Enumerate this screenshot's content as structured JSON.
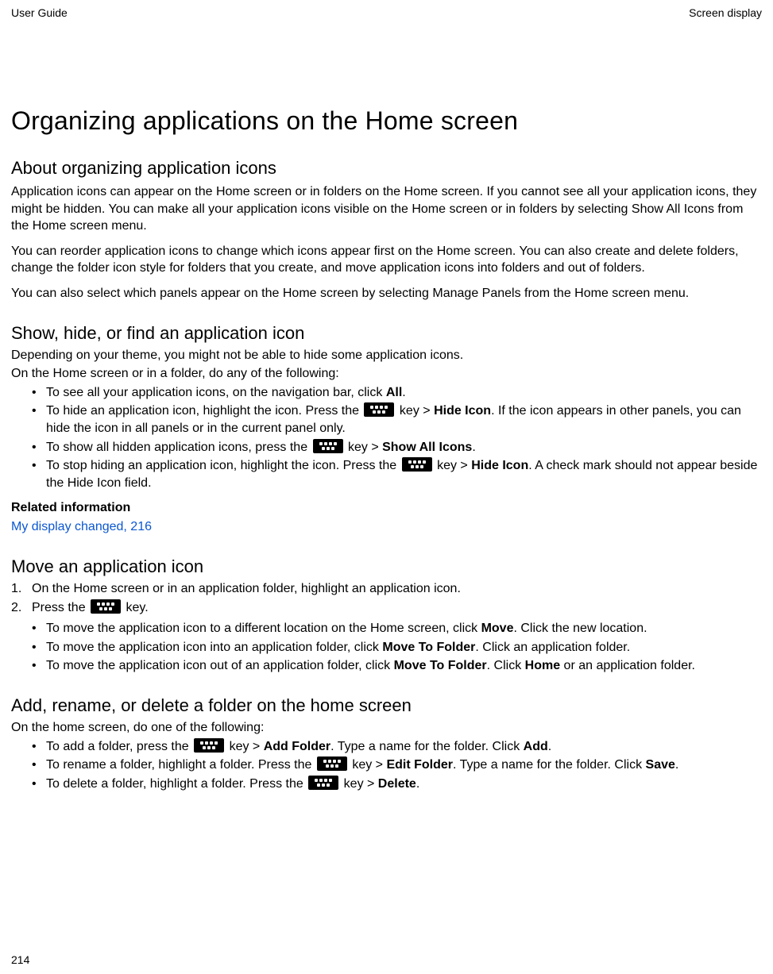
{
  "header": {
    "left": "User Guide",
    "right": "Screen display"
  },
  "title": "Organizing applications on the Home screen",
  "about": {
    "heading": "About organizing application icons",
    "p1": "Application icons can appear on the Home screen or in folders on the Home screen. If you cannot see all your application icons, they might be hidden. You can make all your application icons visible on the Home screen or in folders by selecting Show All Icons from the Home screen menu.",
    "p2": "You can reorder application icons to change which icons appear first on the Home screen. You can also create and delete folders, change the folder icon style for folders that you create, and move application icons into folders and out of folders.",
    "p3": "You can also select which panels appear on the Home screen by selecting Manage Panels from the Home screen menu."
  },
  "show": {
    "heading": "Show, hide, or find an application icon",
    "p1": "Depending on your theme, you might not be able to hide some application icons.",
    "p2": "On the Home screen or in a folder, do any of the following:",
    "items": {
      "b1_a": "To see all your application icons, on the navigation bar, click ",
      "b1_all": "All",
      "b1_b": ".",
      "b2_a": "To hide an application icon, highlight the icon. Press the ",
      "b2_b": " key > ",
      "b2_hide": "Hide Icon",
      "b2_c": ". If the icon appears in other panels, you can hide the icon in all panels or in the current panel only.",
      "b3_a": "To show all hidden application icons, press the ",
      "b3_b": " key > ",
      "b3_show": "Show All Icons",
      "b3_c": ".",
      "b4_a": "To stop hiding an application icon, highlight the icon. Press the ",
      "b4_b": " key > ",
      "b4_hide": "Hide Icon",
      "b4_c": ". A check mark should not appear beside the Hide Icon field."
    },
    "related_label": "Related information",
    "related_link": "My display changed, 216"
  },
  "move": {
    "heading": "Move an application icon",
    "step1": "On the Home screen or in an application folder, highlight an application icon.",
    "step2_a": "Press the ",
    "step2_b": " key.",
    "sub": {
      "b1_a": "To move the application icon to a different location on the Home screen, click ",
      "b1_move": "Move",
      "b1_b": ". Click the new location.",
      "b2_a": "To move the application icon into an application folder, click ",
      "b2_mtf": "Move To Folder",
      "b2_b": ". Click an application folder.",
      "b3_a": "To move the application icon out of an application folder, click ",
      "b3_mtf": "Move To Folder",
      "b3_b": ". Click ",
      "b3_home": "Home",
      "b3_c": " or an application folder."
    }
  },
  "folder": {
    "heading": "Add, rename, or delete a folder on the home screen",
    "p1": "On the home screen, do one of the following:",
    "items": {
      "b1_a": "To add a folder, press the ",
      "b1_b": " key > ",
      "b1_add": "Add Folder",
      "b1_c": ". Type a name for the folder. Click ",
      "b1_addbtn": "Add",
      "b1_d": ".",
      "b2_a": "To rename a folder, highlight a folder. Press the ",
      "b2_b": " key > ",
      "b2_edit": "Edit Folder",
      "b2_c": ". Type a name for the folder. Click ",
      "b2_save": "Save",
      "b2_d": ".",
      "b3_a": "To delete a folder, highlight a folder. Press the ",
      "b3_b": " key > ",
      "b3_del": "Delete",
      "b3_c": "."
    }
  },
  "page_number": "214"
}
